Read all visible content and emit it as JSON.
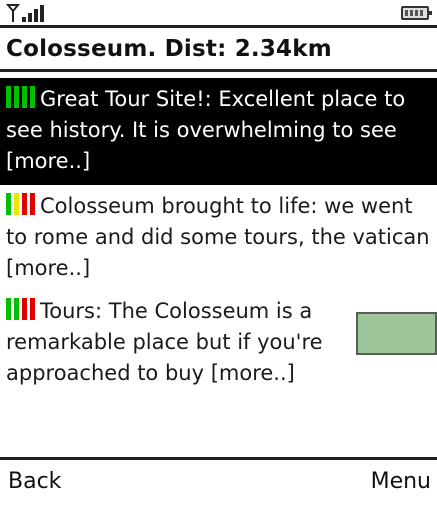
{
  "status": {
    "signal_icon": "antenna-signal-icon",
    "battery_icon": "battery-icon"
  },
  "title": "Colosseum. Dist: 2.34km",
  "reviews": [
    {
      "title": "Great Tour Site!",
      "snippet": "Excellent place to see history. It is overwhelming to see",
      "more": "[more..]",
      "selected": true,
      "rating_colors": [
        "#00c000",
        "#00c000",
        "#00c000",
        "#00c000"
      ]
    },
    {
      "title": "Colosseum brought to life",
      "snippet": "we went to rome and did some tours, the vatican",
      "more": "[more..]",
      "selected": false,
      "rating_colors": [
        "#00c000",
        "#e8e800",
        "#e00000",
        "#e00000"
      ]
    },
    {
      "title": "Tours",
      "snippet": "The Colosseum is a remarkable place but if you're approached to buy",
      "more": "[more..]",
      "selected": false,
      "rating_colors": [
        "#00c000",
        "#00c000",
        "#e00000",
        "#e00000"
      ]
    }
  ],
  "softkeys": {
    "left": "Back",
    "right": "Menu"
  },
  "colors": {
    "selection_bg": "#000000",
    "overlay_box": "#9ec49a"
  }
}
